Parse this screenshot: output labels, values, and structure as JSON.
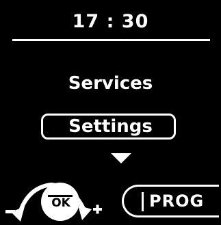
{
  "status": {
    "time": "17 : 30"
  },
  "menu": {
    "items": [
      {
        "label": "Services",
        "selected": false
      },
      {
        "label": "Settings",
        "selected": true
      }
    ]
  },
  "controls": {
    "ok_label": "OK",
    "minus_symbol": "−",
    "plus_symbol": "+",
    "prog_label": "PROG"
  },
  "icons": {
    "scroll_more": "down-triangle-icon",
    "dial": "rotary-dial-icon"
  },
  "colors": {
    "background": "#000000",
    "foreground": "#ffffff"
  }
}
